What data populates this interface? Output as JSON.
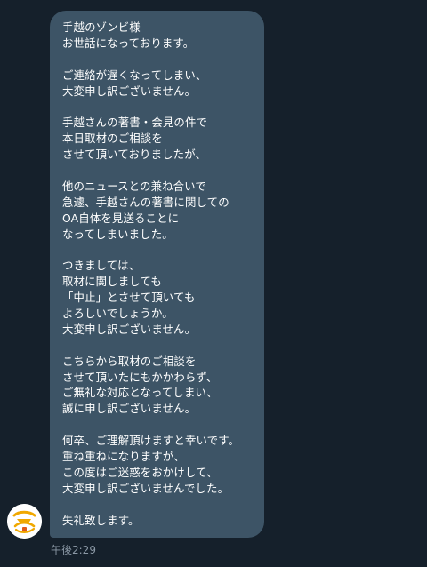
{
  "message": {
    "paragraphs": [
      [
        "手越のゾンビ様",
        "お世話になっております。"
      ],
      [
        "ご連絡が遅くなってしまい、",
        "大変申し訳ございません。"
      ],
      [
        "手越さんの著書・会見の件で",
        "本日取材のご相談を",
        "させて頂いておりましたが、"
      ],
      [
        "他のニュースとの兼ね合いで",
        "急遽、手越さんの著書に関しての",
        "OA自体を見送ることに",
        "なってしまいました。"
      ],
      [
        "つきましては、",
        "取材に関しましても",
        "「中止」とさせて頂いても",
        "よろしいでしょうか。",
        "大変申し訳ございません。"
      ],
      [
        "こちらから取材のご相談を",
        "させて頂いたにもかかわらず、",
        "ご無礼な対応となってしまい、",
        "誠に申し訳ございません。"
      ],
      [
        "何卒、ご理解頂けますと幸いです。",
        "重ね重ねになりますが、",
        "この度はご迷惑をおかけして、",
        "大変申し訳ございませんでした。"
      ],
      [
        "失礼致します。"
      ]
    ],
    "timestamp": "午後2:29"
  },
  "colors": {
    "background": "#15202b",
    "bubble": "#3d5466",
    "text": "#ffffff",
    "timestamp": "#8b98a5",
    "avatar_accent": "#f0a800"
  },
  "avatar": {
    "icon": "sender-logo-icon"
  }
}
